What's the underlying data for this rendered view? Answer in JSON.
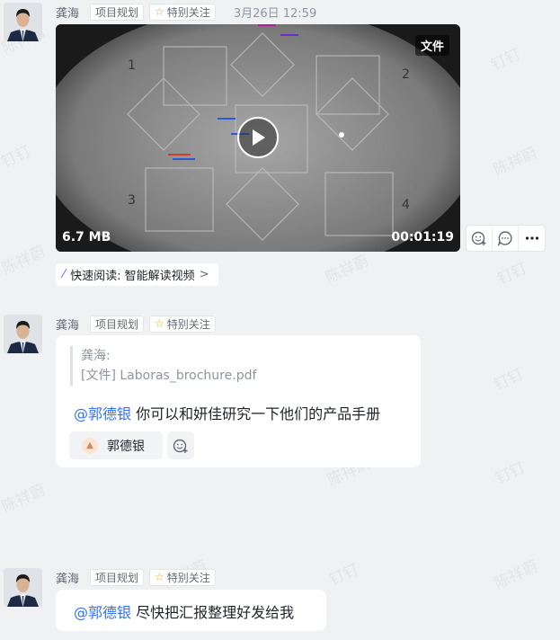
{
  "messages": [
    {
      "sender": "龚海",
      "tag_project": "项目规划",
      "tag_follow": "特别关注",
      "time": "3月26日 12:59",
      "video": {
        "badge": "文件",
        "size": "6.7 MB",
        "duration": "00:01:19"
      },
      "quick_read": "快速阅读: 智能解读视频"
    },
    {
      "sender": "龚海",
      "tag_project": "项目规划",
      "tag_follow": "特别关注",
      "quote_sender": "龚海:",
      "quote_file": "[文件] Laboras_brochure.pdf",
      "mention": "@郭德银",
      "text": " 你可以和妍佳研究一下他们的产品手册",
      "reader_name": "郭德银"
    },
    {
      "sender": "龚海",
      "tag_project": "项目规划",
      "tag_follow": "特别关注",
      "mention": "@郭德银",
      "text": " 尽快把汇报整理好发给我"
    }
  ],
  "watermarks": [
    "钉钉",
    "陈祥蔚"
  ],
  "icons": {
    "follow_star": "star-icon",
    "play": "play-icon",
    "quick_read": "magic-wand-icon",
    "actions": [
      "add-reaction-icon",
      "comment-icon",
      "more-icon"
    ]
  },
  "colors": {
    "accent": "#3370ff",
    "star": "#f5a623",
    "background": "#f0f1f3"
  }
}
